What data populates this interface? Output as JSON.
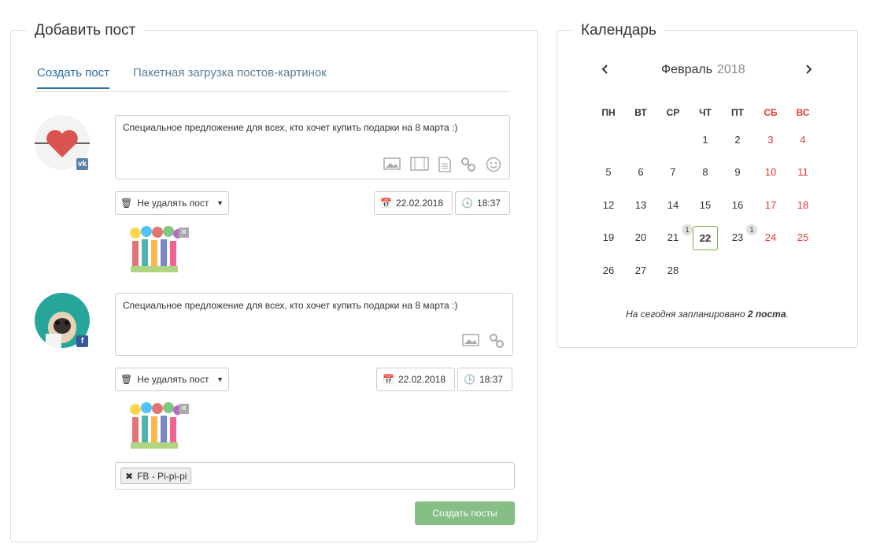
{
  "add_post": {
    "title": "Добавить пост",
    "tabs": [
      "Создать пост",
      "Пакетная загрузка постов-картинок"
    ],
    "posts": [
      {
        "network": "vk",
        "network_badge": "vk",
        "text": "Специальное предложение для всех, кто хочет купить подарки на 8 марта :)",
        "delete_option": "Не удалять пост",
        "date": "22.02.2018",
        "time": "18:37"
      },
      {
        "network": "facebook",
        "network_badge": "f",
        "text": "Специальное предложение для всех, кто хочет купить подарки на 8 марта :)",
        "delete_option": "Не удалять пост",
        "date": "22.02.2018",
        "time": "18:37"
      }
    ],
    "tag": "FB - Pi-pi-pi",
    "submit_label": "Создать посты",
    "colors": {
      "accent": "#2b6ea8",
      "submit": "#86bf86",
      "vk": "#5b7fa6",
      "fb": "#3b5998"
    }
  },
  "calendar": {
    "title": "Календарь",
    "month": "Февраль",
    "year": "2018",
    "weekdays": [
      "ПН",
      "ВТ",
      "СР",
      "ЧТ",
      "ПТ",
      "СБ",
      "ВС"
    ],
    "weeks": [
      [
        "",
        "",
        "",
        "1",
        "2",
        "3",
        "4"
      ],
      [
        "5",
        "6",
        "7",
        "8",
        "9",
        "10",
        "11"
      ],
      [
        "12",
        "13",
        "14",
        "15",
        "16",
        "17",
        "18"
      ],
      [
        "19",
        "20",
        "21",
        "22",
        "23",
        "24",
        "25"
      ],
      [
        "26",
        "27",
        "28",
        "",
        "",
        "",
        ""
      ]
    ],
    "today": "22",
    "post_counts": {
      "21": "1",
      "23": "1"
    },
    "summary_prefix": "На сегодня запланировано",
    "summary_count": "2 поста",
    "summary_suffix": ".",
    "colors": {
      "weekend": "#e53935",
      "today_border": "#7cb342"
    }
  }
}
